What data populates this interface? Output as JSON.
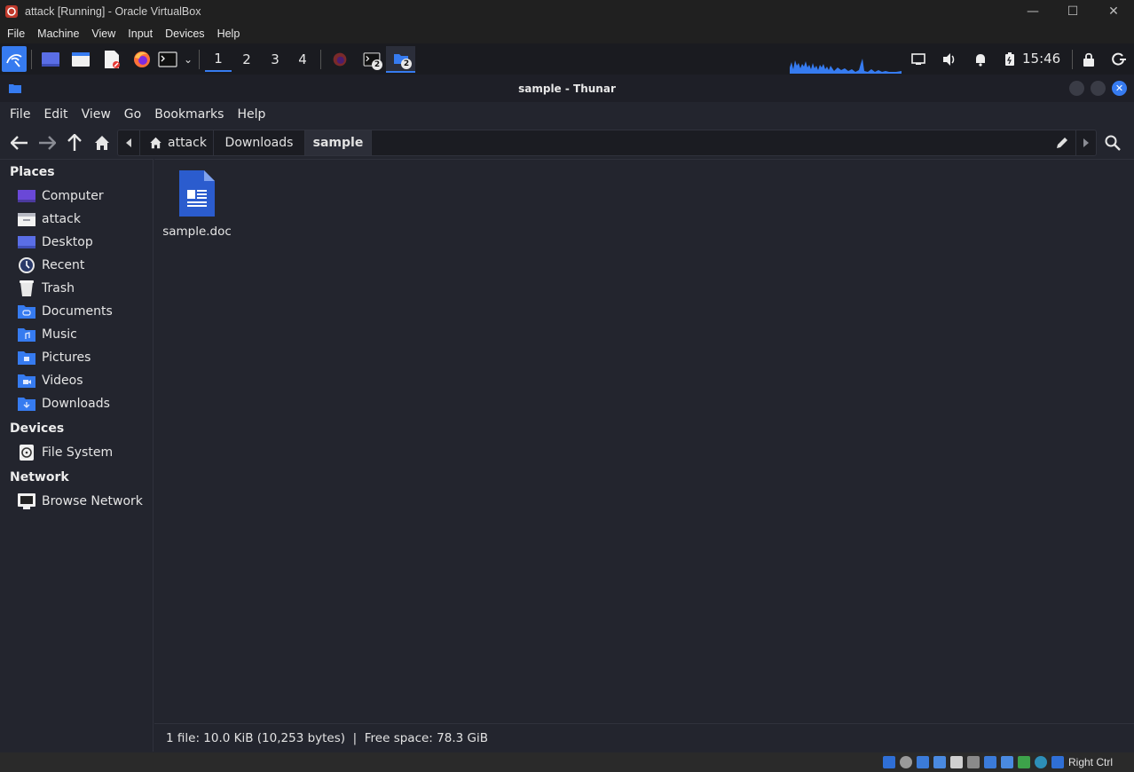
{
  "host_window": {
    "title": "attack [Running] - Oracle VirtualBox",
    "menu": [
      "File",
      "Machine",
      "View",
      "Input",
      "Devices",
      "Help"
    ],
    "controls": [
      "minimize",
      "maximize",
      "close"
    ]
  },
  "panel": {
    "workspaces": [
      "1",
      "2",
      "3",
      "4"
    ],
    "active_workspace": "1",
    "task_badges": [
      "2",
      "2"
    ],
    "clock": "15:46"
  },
  "thunar": {
    "title": "sample - Thunar",
    "menu": [
      "File",
      "Edit",
      "View",
      "Go",
      "Bookmarks",
      "Help"
    ],
    "path": [
      "attack",
      "Downloads",
      "sample"
    ],
    "sidebar": {
      "places_header": "Places",
      "places": [
        "Computer",
        "attack",
        "Desktop",
        "Recent",
        "Trash",
        "Documents",
        "Music",
        "Pictures",
        "Videos",
        "Downloads"
      ],
      "devices_header": "Devices",
      "devices": [
        "File System"
      ],
      "network_header": "Network",
      "network": [
        "Browse Network"
      ]
    },
    "files": [
      {
        "name": "sample.doc",
        "icon": "word-document-icon"
      }
    ],
    "status": "1 file: 10.0 KiB (10,253 bytes)  |  Free space: 78.3 GiB"
  },
  "host_status": {
    "host_key": "Right Ctrl"
  },
  "colors": {
    "accent": "#367bf0",
    "background": "#23252e",
    "panel": "#1a1b20"
  }
}
